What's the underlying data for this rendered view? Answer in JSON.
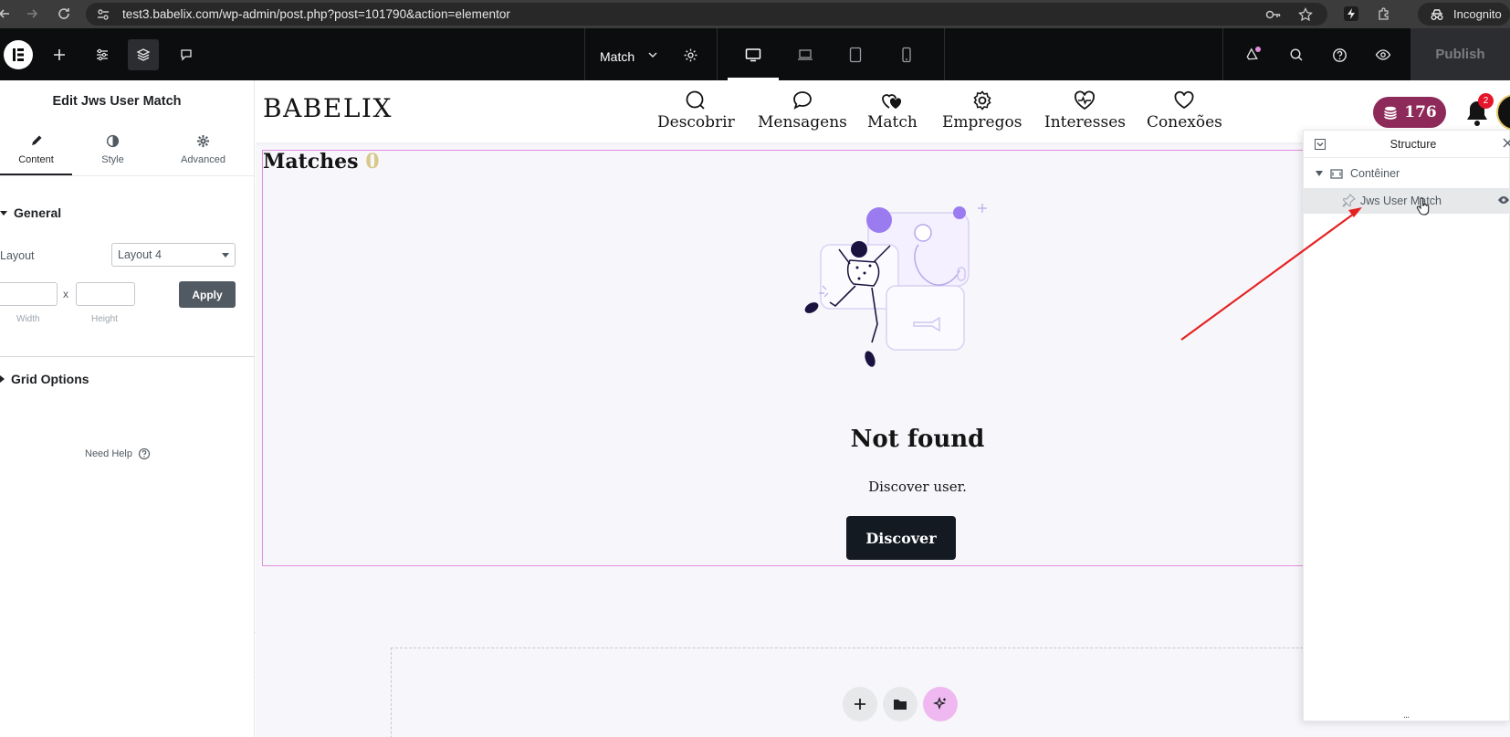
{
  "browser": {
    "url": "test3.babelix.com/wp-admin/post.php?post=101790&action=elementor",
    "incognito_label": "Incognito"
  },
  "topbar": {
    "page_name": "Match",
    "publish_label": "Publish"
  },
  "panel": {
    "title": "Edit Jws User Match",
    "tabs": [
      {
        "label": "Content",
        "icon": "pencil-icon"
      },
      {
        "label": "Style",
        "icon": "half-circle-icon"
      },
      {
        "label": "Advanced",
        "icon": "gear-icon"
      }
    ],
    "general_label": "General",
    "layout_label": "Layout",
    "layout_value": "Layout 4",
    "dim_separator": "x",
    "width_label": "Width",
    "height_label": "Height",
    "apply_label": "Apply",
    "grid_options_label": "Grid Options",
    "need_help_label": "Need Help"
  },
  "site": {
    "logo": "BABELIX",
    "nav": [
      {
        "label": "Descobrir",
        "icon": "search-icon"
      },
      {
        "label": "Mensagens",
        "icon": "chat-bubble-icon"
      },
      {
        "label": "Match",
        "icon": "hearts-icon"
      },
      {
        "label": "Empregos",
        "icon": "gear-icon"
      },
      {
        "label": "Interesses",
        "icon": "heartbeat-icon"
      },
      {
        "label": "Conexões",
        "icon": "heart-icon"
      }
    ],
    "coins": "176",
    "notifications": "2",
    "matches_title": "Matches",
    "matches_count": "0",
    "not_found_title": "Not found",
    "not_found_sub": "Discover user.",
    "discover_label": "Discover"
  },
  "navigator": {
    "title": "Structure",
    "items": [
      {
        "label": "Contêiner"
      },
      {
        "label": "Jws User Match"
      }
    ],
    "resize_handle": "..."
  },
  "colors": {
    "accent": "#e28de0",
    "coins_badge": "#8e2a5a",
    "topbar": "#0c0d0e",
    "annotation_arrow": "#e52222"
  }
}
